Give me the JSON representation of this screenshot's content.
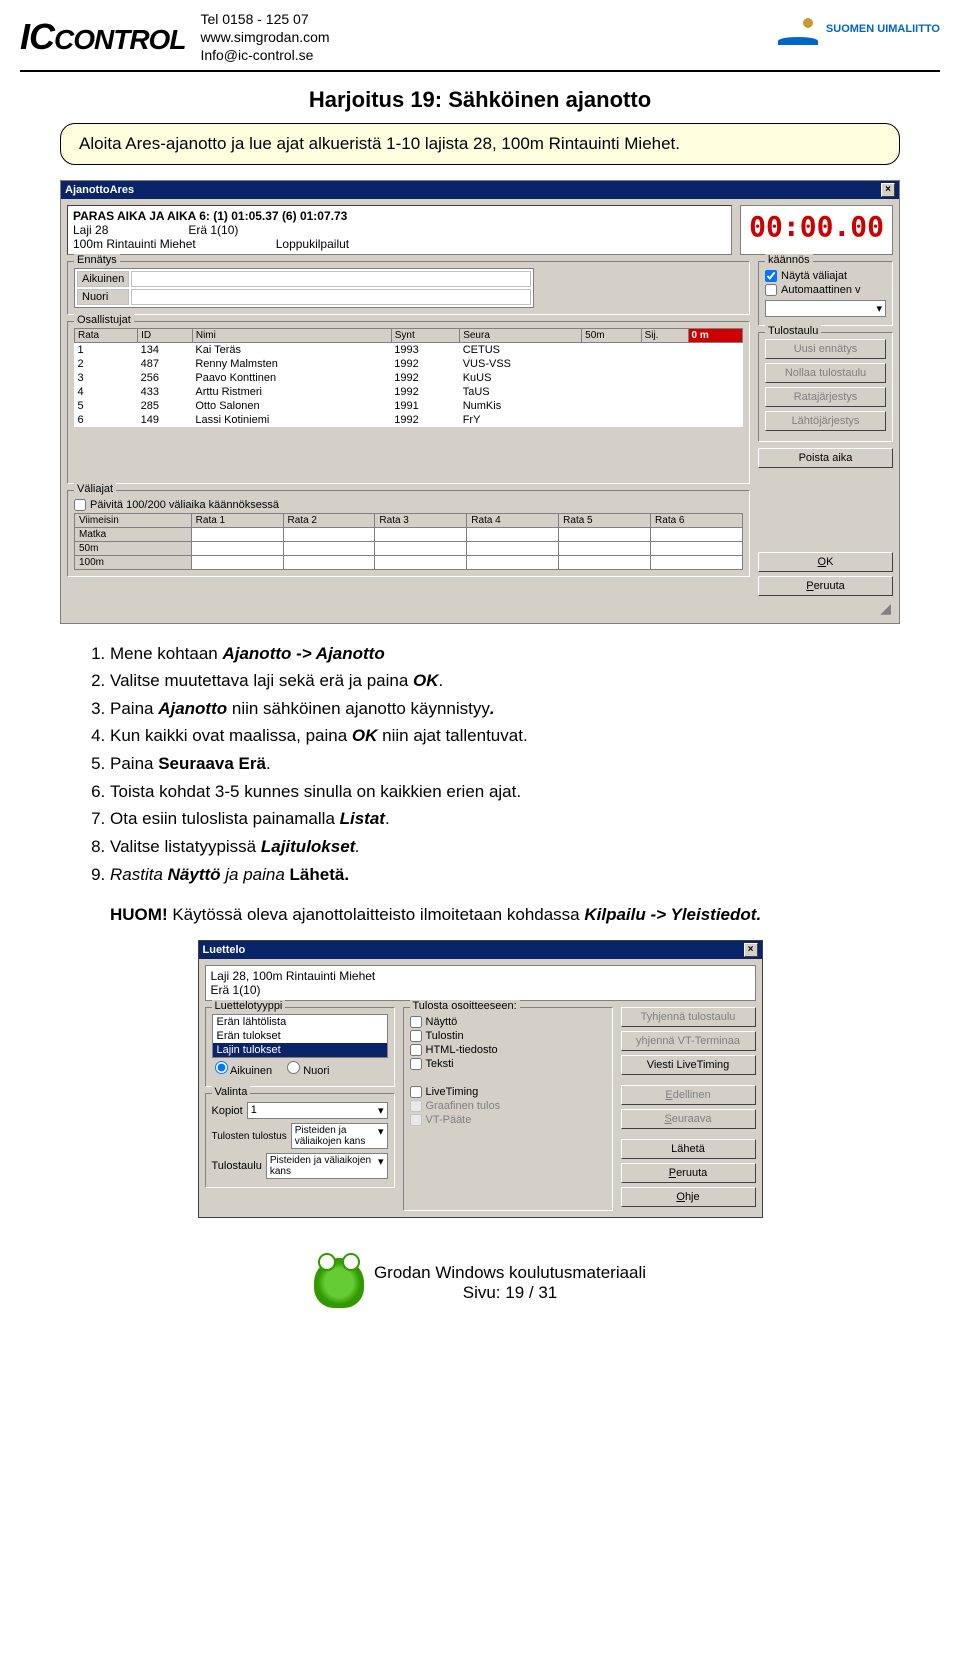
{
  "header": {
    "logo_text": "ICCONTROL",
    "phone": "Tel 0158 - 125 07",
    "web": "www.simgrodan.com",
    "email": "Info@ic-control.se",
    "suomen": "SUOMEN UIMALIITTO"
  },
  "title": "Harjoitus 19: Sähköinen ajanotto",
  "callout": "Aloita Ares-ajanotto ja lue ajat alkueristä 1-10 lajista 28, 100m Rintauinti Miehet.",
  "dialog1": {
    "title": "AjanottoAres",
    "paras": "PARAS AIKA JA AIKA 6: (1) 01:05.37 (6) 01:07.73",
    "laji": "Laji 28",
    "era": "Erä 1(10)",
    "matka": "100m Rintauinti Miehet",
    "loppu": "Loppukilpailut",
    "timer": "00:00.00",
    "ennatys": "Ennätys",
    "aik": "Aikuinen",
    "nuori": "Nuori",
    "osallistujat": "Osallistujat",
    "headers": [
      "Rata",
      "ID",
      "Nimi",
      "Synt",
      "Seura",
      "50m",
      "Sij.",
      "0 m"
    ],
    "rows": [
      [
        "1",
        "134",
        "Kai Teräs",
        "1993",
        "CETUS",
        "",
        ""
      ],
      [
        "2",
        "487",
        "Renny Malmsten",
        "1992",
        "VUS-VSS",
        "",
        ""
      ],
      [
        "3",
        "256",
        "Paavo Konttinen",
        "1992",
        "KuUS",
        "",
        ""
      ],
      [
        "4",
        "433",
        "Arttu Ristmeri",
        "1992",
        "TaUS",
        "",
        ""
      ],
      [
        "5",
        "285",
        "Otto Salonen",
        "1991",
        "NumKis",
        "",
        ""
      ],
      [
        "6",
        "149",
        "Lassi Kotiniemi",
        "1992",
        "FrY",
        "",
        ""
      ]
    ],
    "kaannos": "käännös",
    "nayta_valiajat": "Näytä väliajat",
    "automaattinen": "Automaattinen v",
    "tulostaulu": "Tulostaulu",
    "btn_uusi": "Uusi ennätys",
    "btn_nollaa": "Nollaa tulostaulu",
    "btn_rata": "Ratajärjestys",
    "btn_lahto": "Lähtöjärjestys",
    "btn_poista": "Poista aika",
    "valiajat": "Väliajat",
    "paivita": "Päivitä 100/200 väliaika käännöksessä",
    "vali_headers": [
      "Viimeisin",
      "Rata 1",
      "Rata 2",
      "Rata 3",
      "Rata 4",
      "Rata 5",
      "Rata 6"
    ],
    "vali_rows": [
      "Matka",
      "50m",
      "100m"
    ],
    "btn_ok": "OK",
    "btn_peruuta": "Peruuta"
  },
  "steps": {
    "s1a": "Mene kohtaan ",
    "s1b": "Ajanotto -> Ajanotto",
    "s2a": "Valitse muutettava laji sekä erä ja paina ",
    "s2b": "OK",
    "s2c": ".",
    "s3a": "Paina ",
    "s3b": "Ajanotto",
    "s3c": " niin sähköinen ajanotto käynnistyy",
    "s3d": ".",
    "s4a": "Kun kaikki ovat maalissa, paina ",
    "s4b": "OK",
    "s4c": " niin ajat tallentuvat.",
    "s5a": "Paina ",
    "s5b": "Seuraava Erä",
    "s5c": ".",
    "s6": "Toista kohdat 3-5 kunnes sinulla on kaikkien erien ajat.",
    "s7a": "Ota esiin tuloslista painamalla ",
    "s7b": "Listat",
    "s7c": ".",
    "s8a": "Valitse listatyypissä ",
    "s8b": "Lajitulokset",
    "s8c": ".",
    "s9a": "Rastita ",
    "s9b": "Näyttö",
    "s9c": " ja paina ",
    "s9d": "Lähetä",
    "s9e": "."
  },
  "huom_label": "HUOM!",
  "huom_text": " Käytössä oleva ajanottolaitteisto ilmoitetaan kohdassa ",
  "huom_bold": "Kilpailu -> Yleistiedot.",
  "dialog2": {
    "title": "Luettelo",
    "laji_line": "Laji 28, 100m Rintauinti Miehet",
    "era_line": "Erä 1(10)",
    "luettelotyyppi": "Luettelotyyppi",
    "list_items": [
      "Erän lähtölista",
      "Erän tulokset",
      "Lajin tulokset"
    ],
    "aikuinen": "Aikuinen",
    "nuori": "Nuori",
    "valinta": "Valinta",
    "kopiot": "Kopiot",
    "kopiot_val": "1",
    "tulosten": "Tulosten tulostus",
    "tulostaulu_lbl": "Tulostaulu",
    "pisteet": "Pisteiden ja väliaikojen kans",
    "tulosta_lbl": "Tulosta osoitteeseen:",
    "chk_naytto": "Näyttö",
    "chk_tulostin": "Tulostin",
    "chk_html": "HTML-tiedosto",
    "chk_teksti": "Teksti",
    "chk_livetiming": "LiveTiming",
    "chk_graafinen": "Graafinen tulos",
    "chk_vtpaate": "VT-Pääte",
    "btn_tyhjenna": "Tyhjennä tulostaulu",
    "btn_tyhjenna_vt": "yhjennä VT-Terminaa",
    "btn_viesti": "Viesti LiveTiming",
    "btn_edellinen": "Edellinen",
    "btn_seuraava": "Seuraava",
    "btn_laheta": "Lähetä",
    "btn_peruuta": "Peruuta",
    "btn_ohje": "Ohje"
  },
  "footer": {
    "line1": "Grodan Windows koulutusmateriaali",
    "line2": "Sivu: 19 / 31"
  }
}
